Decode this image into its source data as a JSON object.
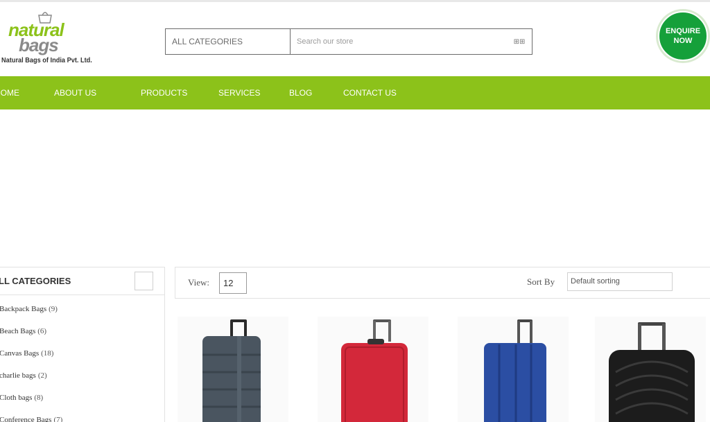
{
  "brand": {
    "logo_word1": "natural",
    "logo_word2": "bags",
    "tagline": "Natural Bags of India Pvt. Ltd."
  },
  "search": {
    "category_label": "ALL CATEGORIES",
    "placeholder": "Search our store",
    "button_glyph": "⊞⊞"
  },
  "enquire": {
    "line1": "ENQUIRE",
    "line2": "NOW"
  },
  "nav": {
    "items": [
      {
        "label": "HOME"
      },
      {
        "label": "ABOUT US"
      },
      {
        "label": "PRODUCTS"
      },
      {
        "label": "SERVICES"
      },
      {
        "label": "BLOG"
      },
      {
        "label": "CONTACT US"
      }
    ]
  },
  "sidebar": {
    "title": "LL CATEGORIES",
    "categories": [
      {
        "name": "Backpack Bags",
        "count": "(9)"
      },
      {
        "name": "Beach Bags",
        "count": "(6)"
      },
      {
        "name": "Canvas Bags",
        "count": "(18)"
      },
      {
        "name": "charlie bags",
        "count": "(2)"
      },
      {
        "name": "Cloth bags",
        "count": "(8)"
      },
      {
        "name": "Conference Bags",
        "count": "(7)"
      }
    ]
  },
  "toolbar": {
    "view_label": "View:",
    "view_value": "12",
    "sort_label": "Sort By",
    "sort_value": "Default sorting"
  },
  "products": [
    {
      "icon": "grey-suitcase-image",
      "color": "#4a5560"
    },
    {
      "icon": "red-suitcase-image",
      "color": "#d3283a"
    },
    {
      "icon": "blue-suitcase-image",
      "color": "#2b4ea3"
    },
    {
      "icon": "black-suitcase-image",
      "color": "#1c1c1c"
    }
  ],
  "colors": {
    "nav_green": "#8cc21a",
    "enquire_green": "#15a03a"
  }
}
